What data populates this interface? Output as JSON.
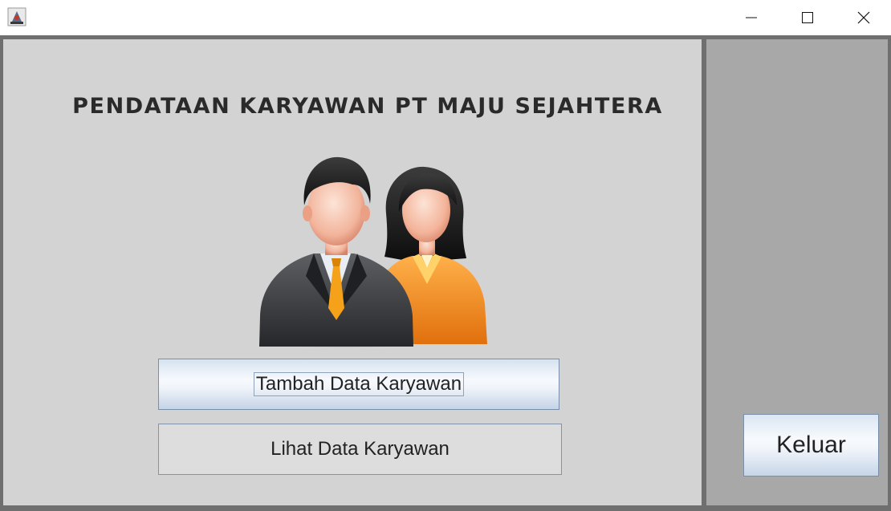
{
  "window": {
    "controls": {
      "minimize_icon": "minimize-icon",
      "maximize_icon": "maximize-icon",
      "close_icon": "close-icon"
    },
    "app_icon": "java-app-icon"
  },
  "main": {
    "title": "PENDATAAN KARYAWAN PT MAJU SEJAHTERA",
    "illustration": "employees-icon",
    "buttons": {
      "add_label": "Tambah Data Karyawan",
      "view_label": "Lihat Data Karyawan"
    }
  },
  "side": {
    "exit_label": "Keluar"
  },
  "colors": {
    "main_panel_bg": "#d3d3d3",
    "side_panel_bg": "#a8a8a8",
    "frame_border": "#6f6f6f",
    "title_text": "#2a2a2a",
    "suit_male": "#3a3b3e",
    "suit_female": "#f08a1c",
    "tie": "#f5a11a"
  }
}
